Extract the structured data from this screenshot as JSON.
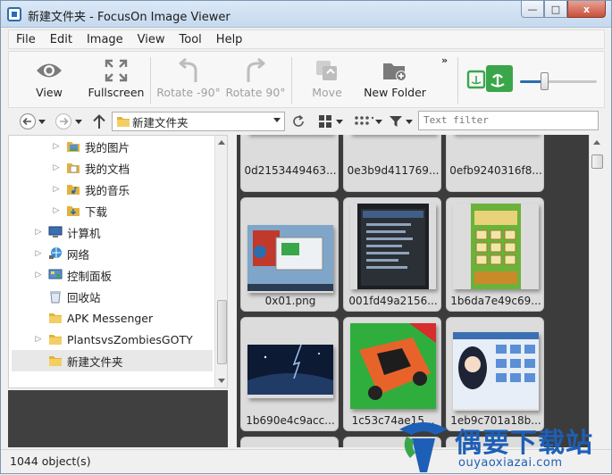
{
  "window": {
    "title": "新建文件夹 - FocusOn Image Viewer",
    "controls": {
      "minimize": "—",
      "maximize": "□",
      "close": "x"
    }
  },
  "menu": [
    "File",
    "Edit",
    "Image",
    "View",
    "Tool",
    "Help"
  ],
  "toolbar": {
    "view": "View",
    "fullscreen": "Fullscreen",
    "rotate_left": "Rotate -90°",
    "rotate_right": "Rotate 90°",
    "move": "Move",
    "new_folder": "New Folder",
    "overflow": "»",
    "zoom_level": 0.32
  },
  "navbar": {
    "path": "新建文件夹",
    "filter_placeholder": "Text filter"
  },
  "tree": {
    "items": [
      {
        "label": "我的图片",
        "icon": "pictures-folder-icon"
      },
      {
        "label": "我的文档",
        "icon": "documents-folder-icon"
      },
      {
        "label": "我的音乐",
        "icon": "music-folder-icon"
      },
      {
        "label": "下载",
        "icon": "downloads-folder-icon"
      },
      {
        "label": "计算机",
        "icon": "computer-icon"
      },
      {
        "label": "网络",
        "icon": "network-icon"
      },
      {
        "label": "控制面板",
        "icon": "control-panel-icon"
      },
      {
        "label": "回收站",
        "icon": "recycle-bin-icon"
      },
      {
        "label": "APK Messenger",
        "icon": "folder-icon"
      },
      {
        "label": "PlantsvsZombiesGOTY",
        "icon": "folder-icon"
      },
      {
        "label": "新建文件夹",
        "icon": "folder-icon",
        "selected": true
      }
    ]
  },
  "thumbnails": [
    {
      "name": "0d2153449463...",
      "art": "orange-cartoon"
    },
    {
      "name": "0e3b9d411769...",
      "art": "green-landscape"
    },
    {
      "name": "0efb9240316f8...",
      "art": "red-circle"
    },
    {
      "name": "0x01.png",
      "art": "desktop-screenshot"
    },
    {
      "name": "001fd49a2156...",
      "art": "dark-settings"
    },
    {
      "name": "1b6da7e49c69...",
      "art": "plants-game"
    },
    {
      "name": "1b690e4c9acc...",
      "art": "blue-sky"
    },
    {
      "name": "1c53c74ae15...",
      "art": "racing-car"
    },
    {
      "name": "1eb9c701a18b...",
      "art": "anime-app"
    }
  ],
  "status": {
    "text": "1044 object(s)"
  },
  "watermark": {
    "title": "偶要下载站",
    "url": "ouyaoxiazai.com"
  },
  "colors": {
    "accent": "#2a6db0",
    "thumb_bg": "#3c3c3c",
    "brand_green": "#3aa64a"
  }
}
